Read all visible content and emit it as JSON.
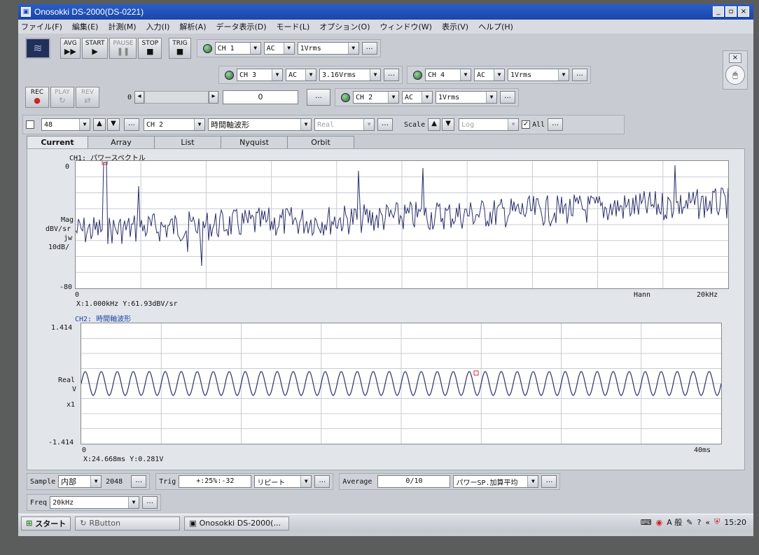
{
  "window": {
    "title": "Onosokki DS-2000(DS-0221)"
  },
  "menu": [
    "ファイル(F)",
    "編集(E)",
    "計測(M)",
    "入力(I)",
    "解析(A)",
    "データ表示(D)",
    "モード(L)",
    "オプション(O)",
    "ウィンドウ(W)",
    "表示(V)",
    "ヘルプ(H)"
  ],
  "toolbar": {
    "avg": "AVG",
    "start": "START",
    "pause": "PAUSE",
    "stop": "STOP",
    "trig": "TRIG",
    "rec": "REC",
    "play": "PLAY",
    "rev": "REV",
    "counter_left": "0",
    "counter_value": "0"
  },
  "channels": [
    {
      "name": "CH 1",
      "coupling": "AC",
      "range": "1Vrms"
    },
    {
      "name": "CH 3",
      "coupling": "AC",
      "range": "3.16Vrms"
    },
    {
      "name": "CH 4",
      "coupling": "AC",
      "range": "1Vrms"
    },
    {
      "name": "CH 2",
      "coupling": "AC",
      "range": "1Vrms"
    }
  ],
  "display_bar": {
    "number": "48",
    "channel": "CH 2",
    "func": "時間軸波形",
    "mode": "Real",
    "scale_label": "Scale",
    "scale_type": "Log",
    "all_label": "All"
  },
  "tabs": [
    "Current",
    "Array",
    "List",
    "Nyquist",
    "Orbit"
  ],
  "graph1": {
    "title": "CH1: パワースペクトル",
    "ytop": "0",
    "ybottom": "-80",
    "ylabel": [
      "Mag",
      "dBV/sr",
      "jw",
      "10dB/"
    ],
    "xleft": "0",
    "xright": "20kHz",
    "window": "Hann",
    "cursor": "X:1.000kHz Y:61.93dBV/sr"
  },
  "graph2": {
    "title": "CH2: 時間軸波形",
    "ytop": "1.414",
    "ybottom": "-1.414",
    "ylabel": [
      "Real",
      "V",
      "x1"
    ],
    "xleft": "0",
    "xright": "40ms",
    "cursor": "X:24.668ms Y:0.281V"
  },
  "bottom": {
    "sample_label": "Sample",
    "sample_source": "内部",
    "sample_count": "2048",
    "trig_label": "Trig",
    "trig_value": "+:25%:-32",
    "trig_mode": "リピート",
    "average_label": "Average",
    "average_value": "0/10",
    "average_mode": "パワーSP.加算平均",
    "freq_label": "Freq",
    "freq_value": "20kHz"
  },
  "taskbar": {
    "start": "スタート",
    "task1": "RButton",
    "task2": "Onosokki DS-2000(...",
    "ime": "A 般",
    "clock": "15:20"
  },
  "colors": {
    "trace": "#2a2f6a",
    "grid": "#c8ccd4",
    "title_blue": "#1a46a8",
    "cursor_red": "#d03030"
  }
}
